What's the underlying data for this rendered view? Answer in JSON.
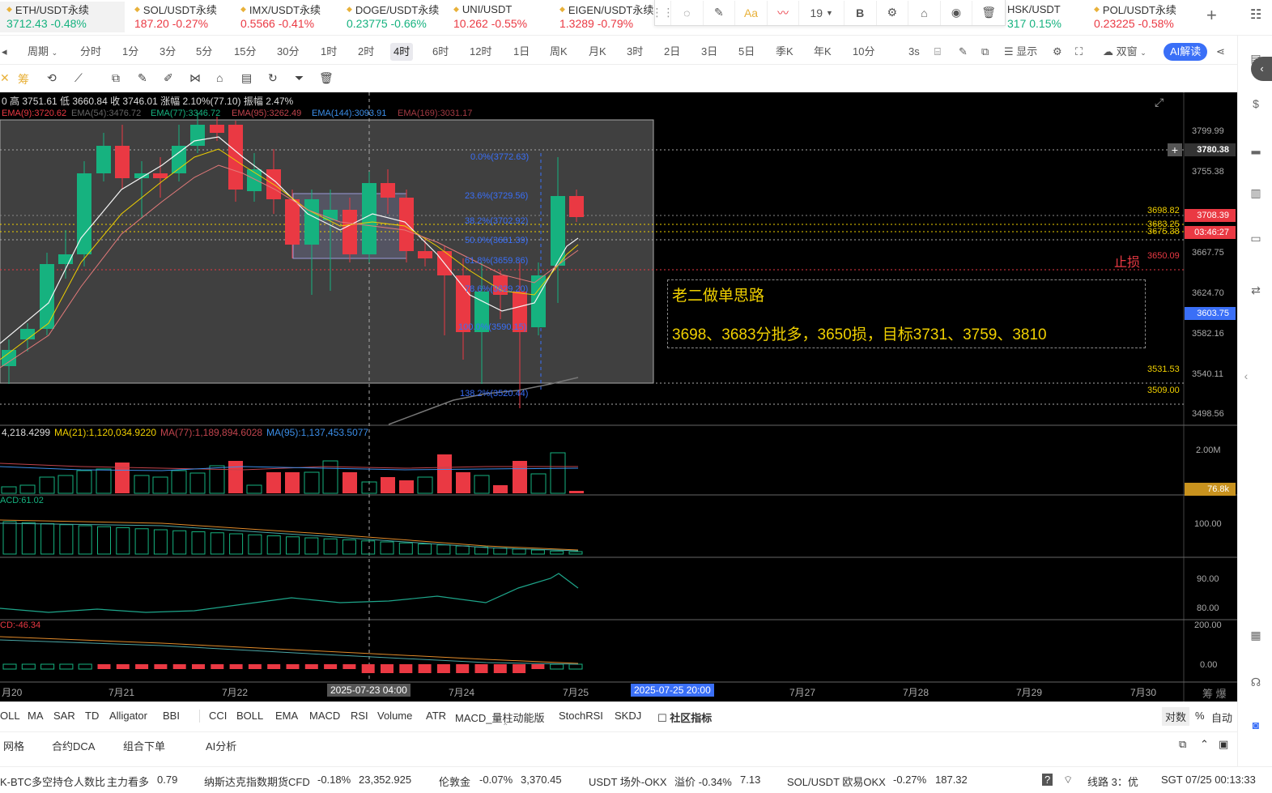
{
  "tickers": [
    {
      "name": "ETH/USDT永续",
      "price": "3712.43",
      "change": "-0.48%",
      "dir": "dn",
      "active": true
    },
    {
      "name": "SOL/USDT永续",
      "price": "187.20",
      "change": "-0.27%",
      "dir": "dn"
    },
    {
      "name": "IMX/USDT永续",
      "price": "0.5566",
      "change": "-0.41%",
      "dir": "dn"
    },
    {
      "name": "DOGE/USDT永续",
      "price": "0.23775",
      "change": "-0.66%",
      "dir": "dn"
    },
    {
      "name": "UNI/USDT",
      "price": "10.262",
      "change": "-0.55%",
      "dir": "dn"
    },
    {
      "name": "EIGEN/USDT永续",
      "price": "1.3289",
      "change": "-0.79%",
      "dir": "dn"
    },
    {
      "name": "HSK/USDT",
      "price": "317",
      "change": "0.15%",
      "dir": "up"
    },
    {
      "name": "POL/USDT永续",
      "price": "0.23225",
      "change": "-0.58%",
      "dir": "dn"
    }
  ],
  "add_tab": "+",
  "drawtools": {
    "font_size": "19",
    "bold": "B"
  },
  "periods": [
    "周期",
    "分时",
    "1分",
    "3分",
    "5分",
    "15分",
    "30分",
    "1时",
    "2时",
    "4时",
    "6时",
    "12时",
    "1日",
    "周K",
    "月K",
    "3时",
    "2日",
    "3日",
    "5日",
    "季K",
    "年K",
    "10分"
  ],
  "active_period": "4时",
  "toolbar_right": {
    "refresh": "3s",
    "display": "显示",
    "double": "双窗",
    "ai": "AI解读"
  },
  "chart_info": {
    "ohlc": "0 高 3751.61 低 3660.84 收 3746.01 涨幅 2.10%(77.10) 振幅 2.47%",
    "ema9": "EMA(9):3720.62",
    "ema54": "EMA(54):3476.72",
    "ema77": "EMA(77):3346.72",
    "ema95": "EMA(95):3262.49",
    "ema144": "EMA(144):3093.91",
    "ema169": "EMA(169):3031.17",
    "vol": "4,218.4299",
    "ma21": "MA(21):1,120,034.9220",
    "ma77": "MA(77):1,189,894.6028",
    "ma95": "MA(95):1,137,453.5077",
    "macd": "ACD:61.02",
    "macd2": "CD:-46.34"
  },
  "price_axis": [
    "3799.99",
    "3755.38",
    "3667.75",
    "3624.70",
    "3582.16",
    "3540.11",
    "3498.56"
  ],
  "price_tags": {
    "crosshair": "3780.38",
    "last": "3708.39",
    "countdown": "03:46:27",
    "cur": "3603.75",
    "vol_last": "76.8k"
  },
  "levels": [
    {
      "text": "3698.82",
      "color": "#f0d000"
    },
    {
      "text": "3683.25",
      "color": "#f0d000"
    },
    {
      "text": "3675.38",
      "color": "#f0d000"
    },
    {
      "text": "3650.09",
      "color": "#ea3943"
    },
    {
      "text": "3531.53",
      "color": "#f0d000"
    },
    {
      "text": "3509.00",
      "color": "#f0d000"
    }
  ],
  "stop_loss": "止损",
  "fib": [
    "0.0%(3772.63)",
    "23.6%(3729.56)",
    "38.2%(3702.92)",
    "50.0%(3681.39)",
    "61.8%(3659.86)",
    "78.6%(3629.20)",
    "100.0%(3590.15)",
    "138.2%(3520.44)"
  ],
  "note": {
    "title": "老二做单思路",
    "body": "3698、3683分批多，3650损，目标3731、3759、3810"
  },
  "sub_axes": {
    "vol": "2.00M",
    "macd": "100.00",
    "rsi_hi": "90.00",
    "rsi_lo": "80.00",
    "k_hi": "200.00",
    "k_lo": "0.00"
  },
  "time_axis": [
    "月20",
    "7月21",
    "7月22",
    "7月24",
    "7月25",
    "7月27",
    "7月28",
    "7月29",
    "7月30"
  ],
  "time_tags": {
    "cross": "2025-07-23 04:00",
    "future": "2025-07-25 20:00"
  },
  "axis_end": "筹 爆",
  "indicators": [
    "OLL",
    "MA",
    "SAR",
    "TD",
    "Alligator",
    "BBI",
    "CCI",
    "BOLL",
    "EMA",
    "MACD",
    "RSI",
    "Volume",
    "ATR",
    "MACD_量柱动能版",
    "StochRSI",
    "SKDJ"
  ],
  "community": "社区指标",
  "axis_modes": [
    "对数",
    "%",
    "自动"
  ],
  "bottom_tabs": [
    "网格",
    "合约DCA",
    "组合下单",
    "AI分析"
  ],
  "status": [
    {
      "label": "K-BTC多空持仓人数比",
      "extra": "主力看多",
      "val": "0.79"
    },
    {
      "label": "纳斯达克指数期货CFD",
      "change": "-0.18%",
      "val": "23,352.925"
    },
    {
      "label": "伦敦金",
      "change": "-0.07%",
      "val": "3,370.45"
    },
    {
      "label": "USDT 场外-OKX",
      "extra": "溢价 -0.34%",
      "val": "7.13"
    },
    {
      "label": "SOL/USDT 欧易OKX",
      "change": "-0.27%",
      "val": "187.32"
    }
  ],
  "line_status": "线路 3：优",
  "clock": "SGT 07/25 00:13:33",
  "colors": {
    "up": "#16b27f",
    "down": "#ea3943",
    "accent": "#3a6ff7",
    "level": "#f0d000"
  }
}
